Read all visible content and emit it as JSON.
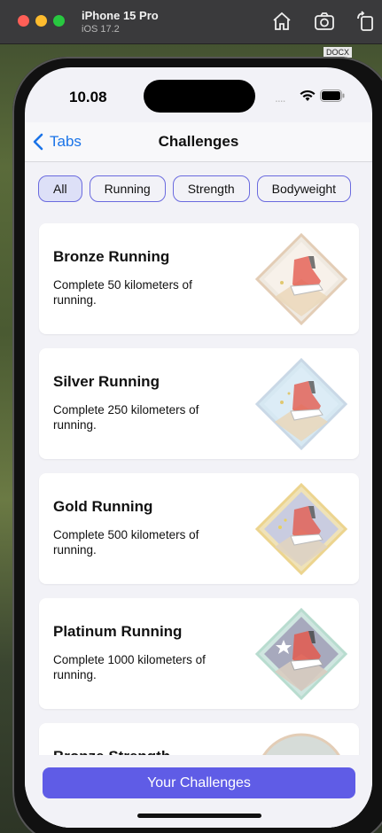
{
  "simulator": {
    "device_name": "iPhone 15 Pro",
    "os_version": "iOS 17.2",
    "background_file_label": "DOCX",
    "icons": [
      "home-icon",
      "screenshot-icon",
      "rotate-icon"
    ]
  },
  "status_bar": {
    "time": "10.08",
    "signal": "....",
    "icons": [
      "wifi-icon",
      "battery-icon"
    ]
  },
  "navbar": {
    "back_label": "Tabs",
    "title": "Challenges"
  },
  "filters": {
    "chips": [
      "All",
      "Running",
      "Strength",
      "Bodyweight"
    ],
    "selected": "All"
  },
  "challenges": [
    {
      "title": "Bronze Running",
      "description": "Complete 50 kilometers of running.",
      "badge": "bronze-running-badge-icon"
    },
    {
      "title": "Silver Running",
      "description": "Complete 250 kilometers of running.",
      "badge": "silver-running-badge-icon"
    },
    {
      "title": "Gold Running",
      "description": "Complete 500 kilometers of running.",
      "badge": "gold-running-badge-icon"
    },
    {
      "title": "Platinum Running",
      "description": "Complete 1000 kilometers of running.",
      "badge": "platinum-running-badge-icon"
    },
    {
      "title": "Bronze Strength",
      "description": "",
      "badge": "bronze-strength-badge-icon"
    }
  ],
  "bottom": {
    "cta_label": "Your Challenges"
  },
  "colors": {
    "accent": "#5f5ce6",
    "link": "#1a73e8",
    "chip_border": "#6a6adf",
    "chip_selected_bg": "#dde0f7",
    "screen_bg": "#f2f2f7"
  }
}
